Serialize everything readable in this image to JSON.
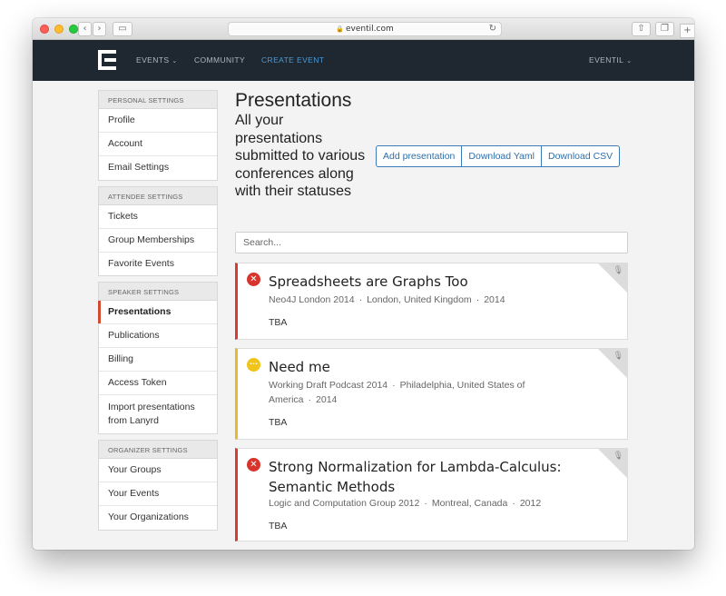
{
  "browser": {
    "url": "eventil.com"
  },
  "nav": {
    "items": [
      {
        "label": "EVENTS"
      },
      {
        "label": "COMMUNITY"
      },
      {
        "label": "CREATE EVENT"
      }
    ],
    "user_menu": "EVENTIL",
    "active_color": "#4a9bd8",
    "background": "#1f2730"
  },
  "sidebar": {
    "groups": [
      {
        "header": "PERSONAL SETTINGS",
        "items": [
          "Profile",
          "Account",
          "Email Settings"
        ]
      },
      {
        "header": "ATTENDEE SETTINGS",
        "items": [
          "Tickets",
          "Group Memberships",
          "Favorite Events"
        ]
      },
      {
        "header": "SPEAKER SETTINGS",
        "items": [
          "Presentations",
          "Publications",
          "Billing",
          "Access Token",
          "Import presentations from Lanyrd"
        ]
      },
      {
        "header": "ORGANIZER SETTINGS",
        "items": [
          "Your Groups",
          "Your Events",
          "Your Organizations"
        ]
      }
    ],
    "active_item": "Presentations",
    "active_color": "#d14b30"
  },
  "main": {
    "title": "Presentations",
    "subtitle": "All your presentations submitted to various conferences along with their statuses",
    "buttons": {
      "add": "Add presentation",
      "yaml": "Download Yaml",
      "csv": "Download CSV"
    },
    "search_placeholder": "Search...",
    "presentations": [
      {
        "status": "rejected",
        "status_color": "#d6342c",
        "title": "Spreadsheets are Graphs Too",
        "event": "Neo4J London 2014",
        "location": "London, United Kingdom",
        "year": "2014",
        "time": "TBA"
      },
      {
        "status": "pending",
        "status_color": "#f0c419",
        "title": "Need me",
        "event": "Working Draft Podcast 2014",
        "location": "Philadelphia, United States of America",
        "year": "2014",
        "time": "TBA"
      },
      {
        "status": "rejected",
        "status_color": "#d6342c",
        "title": "Strong Normalization for Lambda-Calculus: Semantic Methods",
        "event": "Logic and Computation Group 2012",
        "location": "Montreal, Canada",
        "year": "2012",
        "time": "TBA"
      }
    ]
  }
}
